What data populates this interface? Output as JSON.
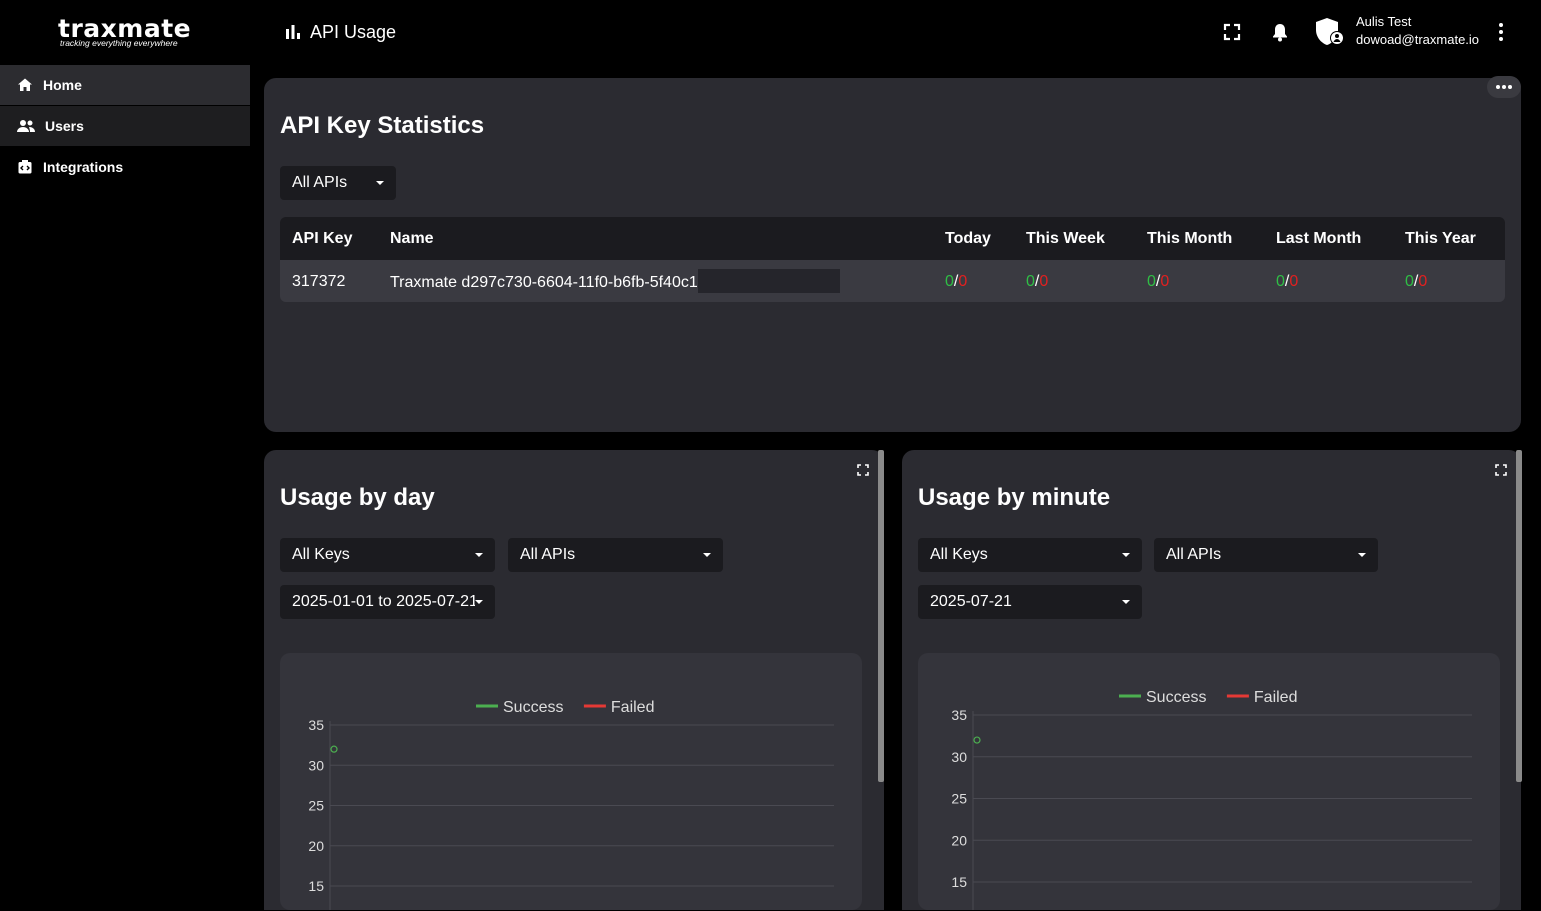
{
  "brand": {
    "name": "traxmate",
    "tagline": "tracking everything everywhere"
  },
  "header": {
    "title": "API Usage",
    "icons": [
      "bar-chart-icon",
      "fullscreen-icon",
      "bell-icon",
      "shield-user-icon",
      "more-vertical-icon"
    ],
    "user": {
      "name": "Aulis Test",
      "email": "dowoad@traxmate.io"
    }
  },
  "sidebar": {
    "items": [
      {
        "label": "Home",
        "icon": "home-icon"
      },
      {
        "label": "Users",
        "icon": "users-icon"
      },
      {
        "label": "Integrations",
        "icon": "integrations-icon"
      }
    ]
  },
  "stats": {
    "title": "API Key Statistics",
    "api_filter": "All APIs",
    "columns": [
      "API Key",
      "Name",
      "Today",
      "This Week",
      "This Month",
      "Last Month",
      "This Year"
    ],
    "rows": [
      {
        "key": "317372",
        "name": "Traxmate d297c730-6604-11f0-b6fb-5f40c1",
        "today": {
          "ok": "0",
          "fail": "0"
        },
        "week": {
          "ok": "0",
          "fail": "0"
        },
        "month": {
          "ok": "0",
          "fail": "0"
        },
        "last_month": {
          "ok": "0",
          "fail": "0"
        },
        "year": {
          "ok": "0",
          "fail": "0"
        }
      }
    ]
  },
  "usage_day": {
    "title": "Usage by day",
    "keys_filter": "All Keys",
    "api_filter": "All APIs",
    "date_range": "2025-01-01 to 2025-07-21"
  },
  "usage_minute": {
    "title": "Usage by minute",
    "keys_filter": "All Keys",
    "api_filter": "All APIs",
    "date": "2025-07-21"
  },
  "colors": {
    "success": "#4caf50",
    "failed": "#e53935",
    "card": "#2b2b31",
    "chart_bg": "#34343b"
  },
  "chart_data": [
    {
      "type": "line",
      "series": [
        {
          "name": "Success",
          "values": [
            32
          ]
        },
        {
          "name": "Failed",
          "values": []
        }
      ],
      "y_ticks": [
        "35",
        "30",
        "25",
        "20",
        "15"
      ],
      "ylim": [
        15,
        35
      ],
      "legend": "top-center",
      "grid": true
    },
    {
      "type": "line",
      "series": [
        {
          "name": "Success",
          "values": [
            32
          ]
        },
        {
          "name": "Failed",
          "values": []
        }
      ],
      "y_ticks": [
        "35",
        "30",
        "25",
        "20",
        "15"
      ],
      "ylim": [
        15,
        35
      ],
      "legend": "top-center",
      "grid": true
    }
  ]
}
